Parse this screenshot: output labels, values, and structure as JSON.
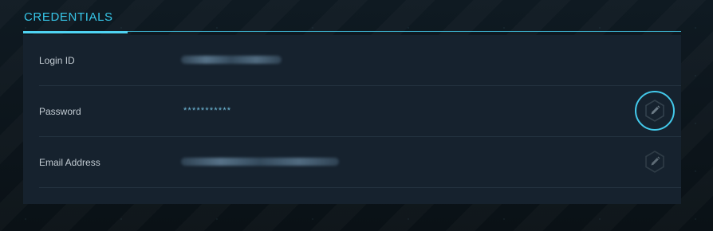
{
  "section": {
    "title": "CREDENTIALS"
  },
  "rows": [
    {
      "label": "Login ID",
      "value_state": "obscured"
    },
    {
      "label": "Password",
      "value": "***********",
      "edit_icon": "pencil-icon",
      "edit_state": "active"
    },
    {
      "label": "Email Address",
      "value_state": "obscured",
      "edit_icon": "pencil-icon",
      "edit_state": "idle"
    }
  ],
  "colors": {
    "accent": "#37c6e8",
    "panel": "#16222e",
    "background": "#0b141a"
  }
}
